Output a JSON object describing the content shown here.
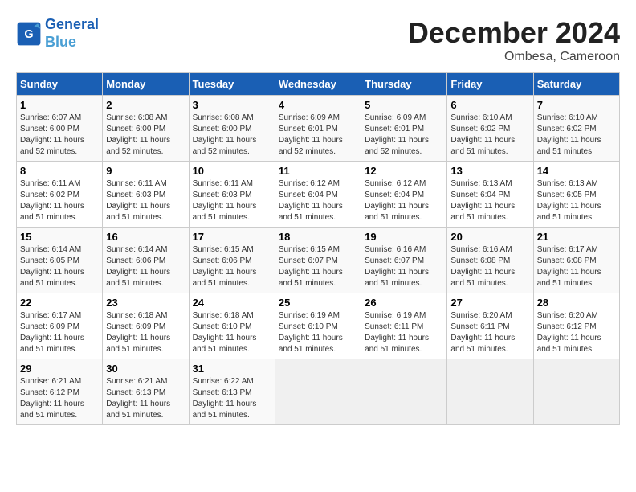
{
  "header": {
    "logo_line1": "General",
    "logo_line2": "Blue",
    "month_title": "December 2024",
    "location": "Ombesa, Cameroon"
  },
  "calendar": {
    "days_of_week": [
      "Sunday",
      "Monday",
      "Tuesday",
      "Wednesday",
      "Thursday",
      "Friday",
      "Saturday"
    ],
    "weeks": [
      [
        {
          "day": "1",
          "info": "Sunrise: 6:07 AM\nSunset: 6:00 PM\nDaylight: 11 hours\nand 52 minutes."
        },
        {
          "day": "2",
          "info": "Sunrise: 6:08 AM\nSunset: 6:00 PM\nDaylight: 11 hours\nand 52 minutes."
        },
        {
          "day": "3",
          "info": "Sunrise: 6:08 AM\nSunset: 6:00 PM\nDaylight: 11 hours\nand 52 minutes."
        },
        {
          "day": "4",
          "info": "Sunrise: 6:09 AM\nSunset: 6:01 PM\nDaylight: 11 hours\nand 52 minutes."
        },
        {
          "day": "5",
          "info": "Sunrise: 6:09 AM\nSunset: 6:01 PM\nDaylight: 11 hours\nand 52 minutes."
        },
        {
          "day": "6",
          "info": "Sunrise: 6:10 AM\nSunset: 6:02 PM\nDaylight: 11 hours\nand 51 minutes."
        },
        {
          "day": "7",
          "info": "Sunrise: 6:10 AM\nSunset: 6:02 PM\nDaylight: 11 hours\nand 51 minutes."
        }
      ],
      [
        {
          "day": "8",
          "info": "Sunrise: 6:11 AM\nSunset: 6:02 PM\nDaylight: 11 hours\nand 51 minutes."
        },
        {
          "day": "9",
          "info": "Sunrise: 6:11 AM\nSunset: 6:03 PM\nDaylight: 11 hours\nand 51 minutes."
        },
        {
          "day": "10",
          "info": "Sunrise: 6:11 AM\nSunset: 6:03 PM\nDaylight: 11 hours\nand 51 minutes."
        },
        {
          "day": "11",
          "info": "Sunrise: 6:12 AM\nSunset: 6:04 PM\nDaylight: 11 hours\nand 51 minutes."
        },
        {
          "day": "12",
          "info": "Sunrise: 6:12 AM\nSunset: 6:04 PM\nDaylight: 11 hours\nand 51 minutes."
        },
        {
          "day": "13",
          "info": "Sunrise: 6:13 AM\nSunset: 6:04 PM\nDaylight: 11 hours\nand 51 minutes."
        },
        {
          "day": "14",
          "info": "Sunrise: 6:13 AM\nSunset: 6:05 PM\nDaylight: 11 hours\nand 51 minutes."
        }
      ],
      [
        {
          "day": "15",
          "info": "Sunrise: 6:14 AM\nSunset: 6:05 PM\nDaylight: 11 hours\nand 51 minutes."
        },
        {
          "day": "16",
          "info": "Sunrise: 6:14 AM\nSunset: 6:06 PM\nDaylight: 11 hours\nand 51 minutes."
        },
        {
          "day": "17",
          "info": "Sunrise: 6:15 AM\nSunset: 6:06 PM\nDaylight: 11 hours\nand 51 minutes."
        },
        {
          "day": "18",
          "info": "Sunrise: 6:15 AM\nSunset: 6:07 PM\nDaylight: 11 hours\nand 51 minutes."
        },
        {
          "day": "19",
          "info": "Sunrise: 6:16 AM\nSunset: 6:07 PM\nDaylight: 11 hours\nand 51 minutes."
        },
        {
          "day": "20",
          "info": "Sunrise: 6:16 AM\nSunset: 6:08 PM\nDaylight: 11 hours\nand 51 minutes."
        },
        {
          "day": "21",
          "info": "Sunrise: 6:17 AM\nSunset: 6:08 PM\nDaylight: 11 hours\nand 51 minutes."
        }
      ],
      [
        {
          "day": "22",
          "info": "Sunrise: 6:17 AM\nSunset: 6:09 PM\nDaylight: 11 hours\nand 51 minutes."
        },
        {
          "day": "23",
          "info": "Sunrise: 6:18 AM\nSunset: 6:09 PM\nDaylight: 11 hours\nand 51 minutes."
        },
        {
          "day": "24",
          "info": "Sunrise: 6:18 AM\nSunset: 6:10 PM\nDaylight: 11 hours\nand 51 minutes."
        },
        {
          "day": "25",
          "info": "Sunrise: 6:19 AM\nSunset: 6:10 PM\nDaylight: 11 hours\nand 51 minutes."
        },
        {
          "day": "26",
          "info": "Sunrise: 6:19 AM\nSunset: 6:11 PM\nDaylight: 11 hours\nand 51 minutes."
        },
        {
          "day": "27",
          "info": "Sunrise: 6:20 AM\nSunset: 6:11 PM\nDaylight: 11 hours\nand 51 minutes."
        },
        {
          "day": "28",
          "info": "Sunrise: 6:20 AM\nSunset: 6:12 PM\nDaylight: 11 hours\nand 51 minutes."
        }
      ],
      [
        {
          "day": "29",
          "info": "Sunrise: 6:21 AM\nSunset: 6:12 PM\nDaylight: 11 hours\nand 51 minutes."
        },
        {
          "day": "30",
          "info": "Sunrise: 6:21 AM\nSunset: 6:13 PM\nDaylight: 11 hours\nand 51 minutes."
        },
        {
          "day": "31",
          "info": "Sunrise: 6:22 AM\nSunset: 6:13 PM\nDaylight: 11 hours\nand 51 minutes."
        },
        {
          "day": "",
          "info": ""
        },
        {
          "day": "",
          "info": ""
        },
        {
          "day": "",
          "info": ""
        },
        {
          "day": "",
          "info": ""
        }
      ]
    ]
  }
}
